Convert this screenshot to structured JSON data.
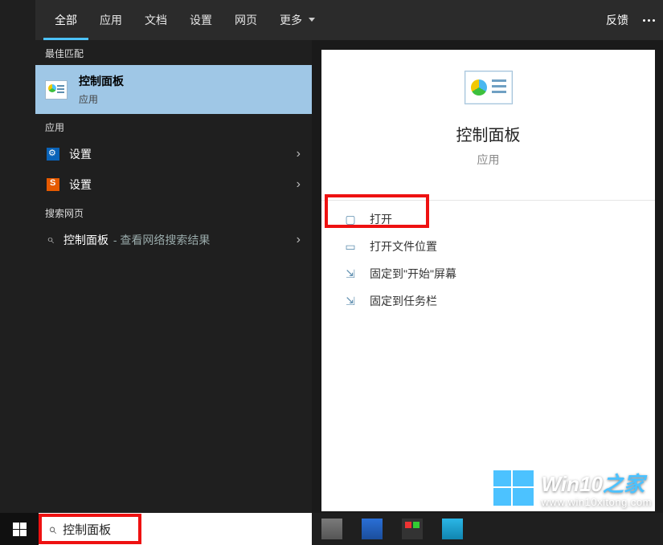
{
  "tabs": {
    "items": [
      "全部",
      "应用",
      "文档",
      "设置",
      "网页",
      "更多"
    ],
    "active_index": 0,
    "feedback": "反馈"
  },
  "results": {
    "best_label": "最佳匹配",
    "best": {
      "title": "控制面板",
      "subtitle": "应用"
    },
    "apps_label": "应用",
    "apps": [
      {
        "label": "设置",
        "icon": "gear-blue"
      },
      {
        "label": "设置",
        "icon": "gear-orange"
      }
    ],
    "web_label": "搜索网页",
    "web": {
      "term": "控制面板",
      "suffix": " - 查看网络搜索结果"
    }
  },
  "detail": {
    "title": "控制面板",
    "subtitle": "应用",
    "actions": [
      {
        "icon": "open-icon",
        "label": "打开",
        "highlight": true
      },
      {
        "icon": "folder-icon",
        "label": "打开文件位置"
      },
      {
        "icon": "pin-start-icon",
        "label": "固定到\"开始\"屏幕"
      },
      {
        "icon": "pin-taskbar-icon",
        "label": "固定到任务栏"
      }
    ]
  },
  "taskbar": {
    "search_value": "控制面板"
  },
  "watermark": {
    "brand_a": "Win10",
    "brand_b": "之家",
    "url": "www.win10xitong.com"
  }
}
